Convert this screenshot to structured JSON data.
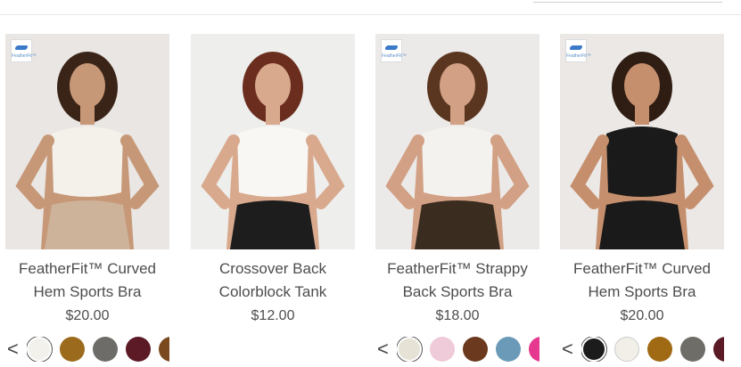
{
  "products": [
    {
      "title_1": "FeatherFit™ Curved",
      "title_2": "Hem Sports Bra",
      "price": "$20.00",
      "logo_text": "FeatherFit™",
      "bg": "#e9e6e3",
      "top": "#f3f1ea",
      "bottom": "#cdb39a",
      "skin": "#c79878",
      "hair": "#3a2418"
    },
    {
      "title_1": "Crossover Back",
      "title_2": "Colorblock Tank",
      "price": "$12.00",
      "logo_text": "",
      "bg": "#eeeeec",
      "top": "#f8f7f3",
      "bottom": "#1d1d1d",
      "skin": "#d8a98d",
      "hair": "#6b2e1e"
    },
    {
      "title_1": "FeatherFit™ Strappy",
      "title_2": "Back Sports Bra",
      "price": "$18.00",
      "logo_text": "FeatherFit™",
      "bg": "#eceae8",
      "top": "#f4f2ee",
      "bottom": "#3b2c20",
      "skin": "#d2a084",
      "hair": "#5a3520"
    },
    {
      "title_1": "FeatherFit™ Curved",
      "title_2": "Hem Sports Bra",
      "price": "$20.00",
      "logo_text": "FeatherFit™",
      "bg": "#ebe8e6",
      "top": "#1a1a1a",
      "bottom": "#1a1a1a",
      "skin": "#c58f6d",
      "hair": "#2f1c12"
    }
  ],
  "swatch_sets": [
    {
      "arrow": "<",
      "colors": [
        "#f2f1ec",
        "#9c6a1c",
        "#6d6c68",
        "#5b1a25",
        "#7a4a1e"
      ]
    },
    {
      "arrow": "<",
      "colors": [
        "#e6e2d6",
        "#efcad8",
        "#6b3a1e",
        "#6b9ab8",
        "#e6388f"
      ]
    },
    {
      "arrow": "<",
      "colors": [
        "#1c1c1c",
        "#f1efe8",
        "#a06a14",
        "#6e6d68",
        "#5a1a26"
      ]
    }
  ]
}
